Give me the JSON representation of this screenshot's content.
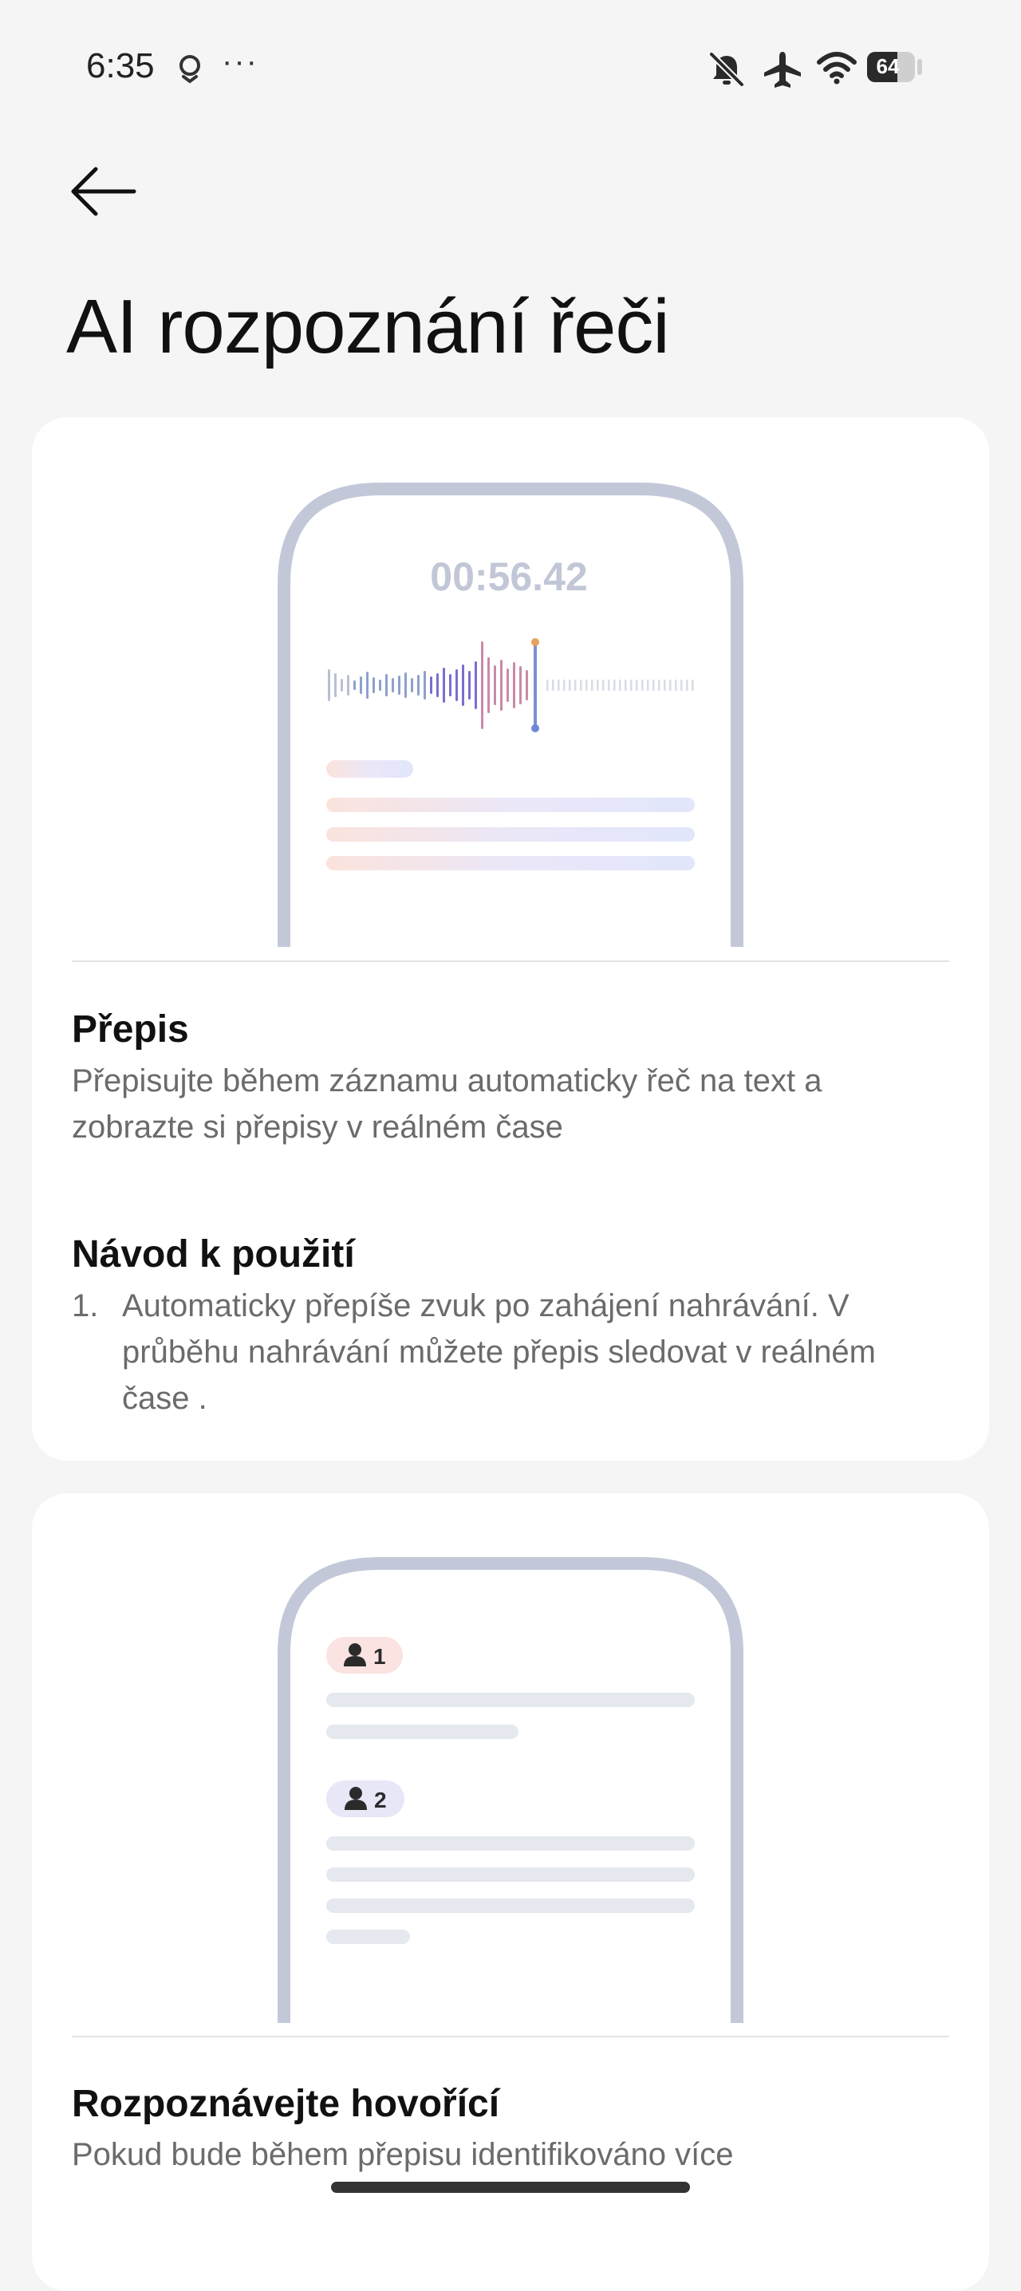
{
  "status_bar": {
    "time": "6:35",
    "more": "···",
    "battery": "64",
    "battery_level": 0.64,
    "icons": [
      "location-ring-icon",
      "more-dots-icon",
      "mute-bell-icon",
      "airplane-icon",
      "wifi-icon",
      "battery-icon"
    ]
  },
  "header": {
    "back_icon": "arrow-left-icon",
    "title": "AI rozpoznání řeči"
  },
  "card1": {
    "timer": "00:56.42",
    "section_title": "Přepis",
    "section_text": "Přepisujte během záznamu automaticky řeč na text a zobrazte si přepisy v reálném čase",
    "guide_title": "Návod k použití",
    "step_num": "1.",
    "step_text": "Automaticky přepíše zvuk po zahájení nahrávání. V průběhu nahrávání můžete přepis sledovat v reálném čase ."
  },
  "card2": {
    "speaker1": "1",
    "speaker2": "2",
    "section_title": "Rozpoznávejte hovořící",
    "section_text": "Pokud bude během přepisu identifikováno více"
  },
  "colors": {
    "background": "#f5f5f5",
    "card": "#ffffff",
    "phone_frame": "#c3c8d9",
    "muted_text": "#6b6b6b",
    "speaker1_chip": "#fbe3e2",
    "speaker2_chip": "#e7e7f8"
  }
}
